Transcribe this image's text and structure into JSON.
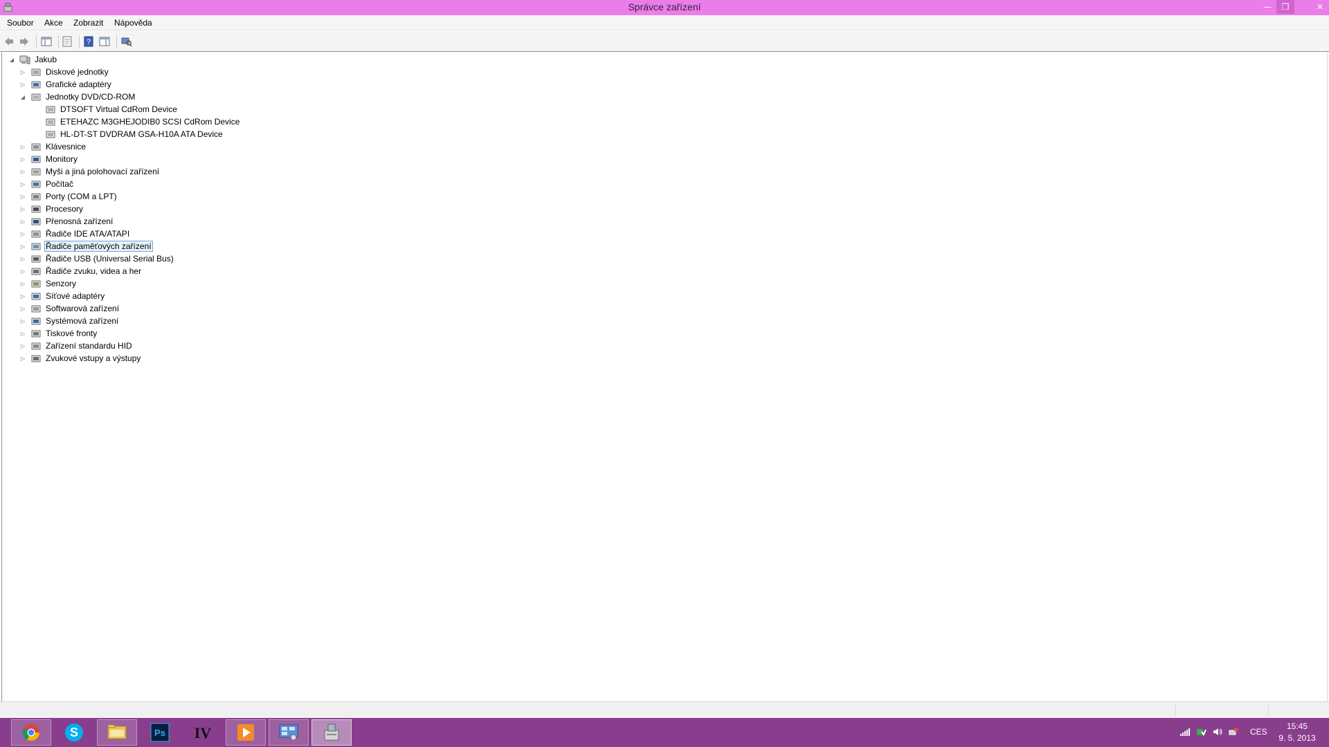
{
  "window": {
    "title": "Správce zařízení",
    "accent_color": "#ea7de9",
    "controls": {
      "minimize_icon": "minimize-icon",
      "restore_icon": "restore-icon",
      "close_icon": "close-icon"
    }
  },
  "menu": {
    "items": [
      "Soubor",
      "Akce",
      "Zobrazit",
      "Nápověda"
    ]
  },
  "toolbar": {
    "icons": [
      "back-arrow-icon",
      "forward-arrow-icon",
      "show-hide-tree-icon",
      "properties-icon",
      "help-icon",
      "action-pane-icon",
      "scan-hardware-icon"
    ]
  },
  "tree": {
    "root": "Jakub",
    "nodes": [
      {
        "label": "Diskové jednotky",
        "icon": "disk-drive-icon",
        "expanded": false
      },
      {
        "label": "Grafické adaptéry",
        "icon": "display-adapter-icon",
        "expanded": false
      },
      {
        "label": "Jednotky DVD/CD-ROM",
        "icon": "dvd-drive-icon",
        "expanded": true
      },
      {
        "label": "DTSOFT Virtual CdRom Device",
        "icon": "dvd-drive-icon",
        "child": true
      },
      {
        "label": "ETEHAZC M3GHEJODIB0 SCSI CdRom Device",
        "icon": "dvd-drive-icon",
        "child": true
      },
      {
        "label": "HL-DT-ST DVDRAM GSA-H10A ATA Device",
        "icon": "dvd-drive-icon",
        "child": true
      },
      {
        "label": "Klávesnice",
        "icon": "keyboard-icon",
        "expanded": false
      },
      {
        "label": "Monitory",
        "icon": "monitor-icon",
        "expanded": false
      },
      {
        "label": "Myši a jiná polohovací zařízení",
        "icon": "mouse-icon",
        "expanded": false
      },
      {
        "label": "Počítač",
        "icon": "computer-icon",
        "expanded": false
      },
      {
        "label": "Porty (COM a LPT)",
        "icon": "port-icon",
        "expanded": false
      },
      {
        "label": "Procesory",
        "icon": "processor-icon",
        "expanded": false
      },
      {
        "label": "Přenosná zařízení",
        "icon": "portable-device-icon",
        "expanded": false
      },
      {
        "label": "Řadiče IDE ATA/ATAPI",
        "icon": "ide-controller-icon",
        "expanded": false
      },
      {
        "label": "Řadiče paměťových zařízení",
        "icon": "storage-controller-icon",
        "expanded": false,
        "selected": true
      },
      {
        "label": "Řadiče USB (Universal Serial Bus)",
        "icon": "usb-icon",
        "expanded": false
      },
      {
        "label": "Řadiče zvuku, videa a her",
        "icon": "speaker-icon",
        "expanded": false
      },
      {
        "label": "Senzory",
        "icon": "sensor-icon",
        "expanded": false
      },
      {
        "label": "Síťové adaptéry",
        "icon": "network-adapter-icon",
        "expanded": false
      },
      {
        "label": "Softwarová zařízení",
        "icon": "software-device-icon",
        "expanded": false
      },
      {
        "label": "Systémová zařízení",
        "icon": "system-device-icon",
        "expanded": false
      },
      {
        "label": "Tiskové fronty",
        "icon": "printer-icon",
        "expanded": false
      },
      {
        "label": "Zařízení standardu HID",
        "icon": "hid-icon",
        "expanded": false
      },
      {
        "label": "Zvukové vstupy a výstupy",
        "icon": "audio-io-icon",
        "expanded": false
      }
    ]
  },
  "taskbar": {
    "color": "#883e8d",
    "apps": [
      {
        "name": "chrome",
        "icon": "chrome-icon",
        "label": ""
      },
      {
        "name": "skype",
        "icon": "skype-icon",
        "label": "S"
      },
      {
        "name": "explorer",
        "icon": "folder-icon",
        "label": ""
      },
      {
        "name": "photoshop",
        "icon": "photoshop-icon",
        "label": "Ps"
      },
      {
        "name": "irfanview",
        "icon": "irfanview-icon",
        "label": "IV"
      },
      {
        "name": "media-player",
        "icon": "media-player-icon",
        "label": ""
      },
      {
        "name": "control-panel",
        "icon": "control-panel-icon",
        "label": ""
      },
      {
        "name": "device-manager",
        "icon": "device-manager-icon",
        "label": ""
      }
    ],
    "tray": {
      "icons": [
        "signal-icon",
        "security-icon",
        "volume-icon",
        "network-icon"
      ],
      "language": "CES",
      "time": "15:45",
      "date": "9. 5. 2013"
    }
  }
}
